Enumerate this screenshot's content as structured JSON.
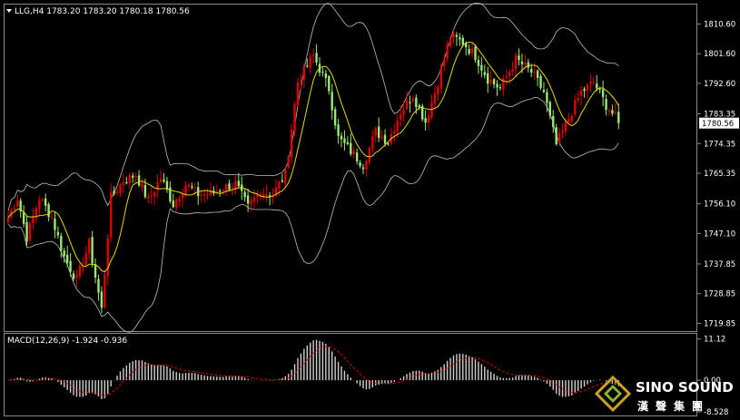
{
  "header": {
    "symbol": "LLG,H4",
    "open": "1783.20",
    "high": "1783.20",
    "low": "1780.18",
    "close": "1780.56"
  },
  "colors": {
    "background": "#000000",
    "panel_border": "#8a8a8a",
    "up_candle": "#e00000",
    "down_candle": "#9be878",
    "bollinger": "#bfbfbf",
    "moving_average": "#e8d800",
    "macd_hist": "#d0d0d0",
    "macd_signal": "#e00000",
    "current_price_box": "#ffffff"
  },
  "chart_data": [
    {
      "type": "candlestick",
      "symbol": "LLG",
      "timeframe": "H4",
      "indicators": [
        "Bollinger Bands",
        "Moving Average"
      ],
      "current_price": 1780.56,
      "current_price_label": "1780.56",
      "ylim": [
        1717.5,
        1816.5
      ],
      "yticks": [
        1810.6,
        1801.6,
        1792.6,
        1783.35,
        1774.35,
        1765.35,
        1756.1,
        1747.1,
        1737.85,
        1728.85,
        1719.85
      ],
      "ytick_labels": [
        "1810.60",
        "1801.60",
        "1792.60",
        "1783.35",
        "1774.35",
        "1765.35",
        "1756.10",
        "1747.10",
        "1737.85",
        "1728.85",
        "1719.85"
      ],
      "grid": false,
      "anchors": [
        [
          0,
          1752
        ],
        [
          3,
          1758
        ],
        [
          6,
          1746
        ],
        [
          10,
          1758
        ],
        [
          14,
          1752
        ],
        [
          18,
          1740
        ],
        [
          22,
          1733
        ],
        [
          26,
          1744
        ],
        [
          30,
          1724
        ],
        [
          33,
          1758
        ],
        [
          37,
          1763
        ],
        [
          41,
          1765
        ],
        [
          45,
          1757
        ],
        [
          49,
          1764
        ],
        [
          53,
          1756
        ],
        [
          57,
          1762
        ],
        [
          61,
          1759
        ],
        [
          65,
          1759
        ],
        [
          69,
          1761
        ],
        [
          73,
          1762
        ],
        [
          77,
          1755
        ],
        [
          81,
          1760
        ],
        [
          85,
          1759
        ],
        [
          89,
          1765
        ],
        [
          93,
          1793
        ],
        [
          98,
          1801
        ],
        [
          103,
          1791
        ],
        [
          106,
          1776
        ],
        [
          110,
          1772
        ],
        [
          114,
          1768
        ],
        [
          118,
          1778
        ],
        [
          122,
          1775
        ],
        [
          126,
          1784
        ],
        [
          130,
          1789
        ],
        [
          134,
          1781
        ],
        [
          138,
          1793
        ],
        [
          142,
          1807
        ],
        [
          146,
          1805
        ],
        [
          150,
          1801
        ],
        [
          154,
          1794
        ],
        [
          158,
          1791
        ],
        [
          163,
          1800
        ],
        [
          168,
          1796
        ],
        [
          172,
          1790
        ],
        [
          176,
          1774
        ],
        [
          180,
          1782
        ],
        [
          184,
          1790
        ],
        [
          188,
          1793
        ],
        [
          192,
          1786
        ],
        [
          196,
          1781
        ]
      ]
    },
    {
      "type": "bar",
      "indicator": "MACD",
      "params": "12,26,9",
      "label": "MACD(12,26,9)",
      "macd": -1.924,
      "signal": -0.936,
      "macd_label": "-1.924",
      "signal_label": "-0.936",
      "ylim": [
        -9.5,
        12.5
      ],
      "yticks": [
        11.12,
        0.0,
        -8.528
      ],
      "ytick_labels": [
        "11.12",
        "0.00",
        "-8.528"
      ]
    }
  ],
  "watermark": {
    "brand_name": "SINO SOUND",
    "chinese_name": "漢聲集團"
  }
}
